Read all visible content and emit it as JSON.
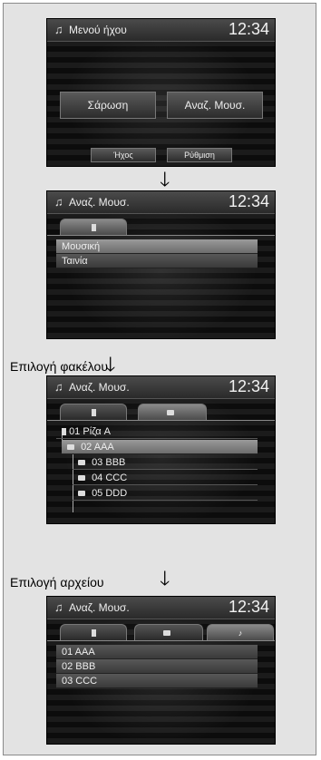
{
  "screens": [
    {
      "header": {
        "title": "Μενού ήχου",
        "time": "12:34",
        "icon": "music-note-icon"
      },
      "buttons": {
        "scan": "Σάρωση",
        "search_music": "Αναζ. Μουσ.",
        "sound": "Ήχος",
        "settings": "Ρύθμιση"
      }
    },
    {
      "header": {
        "title": "Αναζ. Μουσ.",
        "time": "12:34",
        "icon": "music-note-icon"
      },
      "tabs": [
        {
          "icon": "usb-icon"
        }
      ],
      "rows": [
        "Μουσική",
        "Ταινία"
      ]
    },
    {
      "caption": "Επιλογή φακέλου",
      "header": {
        "title": "Αναζ. Μουσ.",
        "time": "12:34",
        "icon": "music-note-icon"
      },
      "tabs": [
        {
          "icon": "usb-icon"
        },
        {
          "icon": "folder-icon"
        }
      ],
      "rows": [
        "01 Ρίζα A",
        "02 AAA",
        "03 BBB",
        "04 CCC",
        "05 DDD"
      ]
    },
    {
      "caption": "Επιλογή αρχείου",
      "header": {
        "title": "Αναζ. Μουσ.",
        "time": "12:34",
        "icon": "music-note-icon"
      },
      "tabs": [
        {
          "icon": "usb-icon"
        },
        {
          "icon": "folder-icon"
        },
        {
          "icon": "music-note-icon",
          "glyph": "♪"
        }
      ],
      "rows": [
        "01 AAA",
        "02 BBB",
        "03 CCC"
      ]
    }
  ],
  "arrow_glyph": "➘"
}
